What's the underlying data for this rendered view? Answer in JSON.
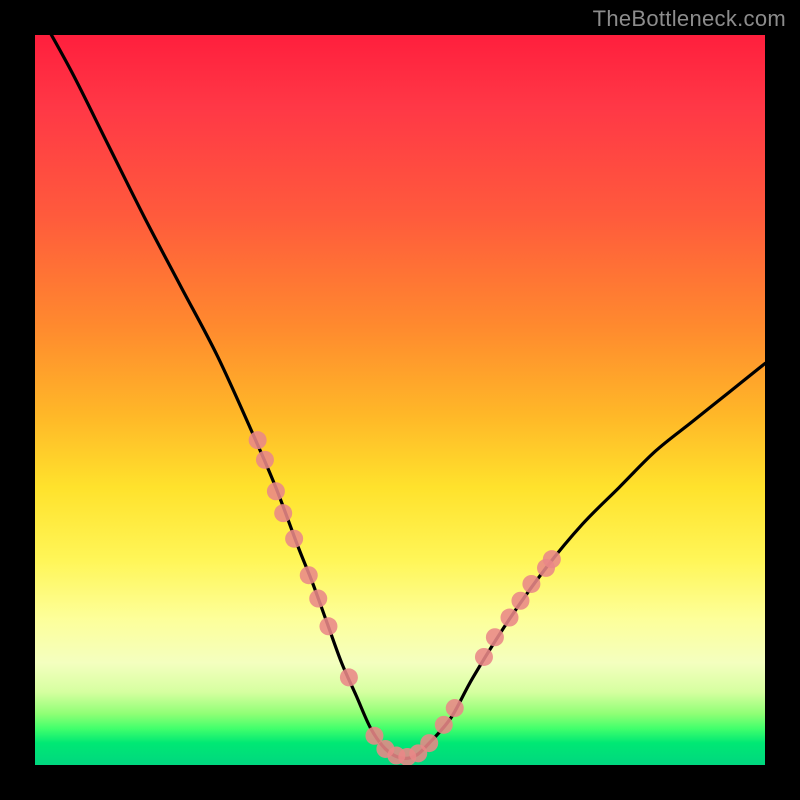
{
  "watermark": {
    "text": "TheBottleneck.com"
  },
  "colors": {
    "frame": "#000000",
    "curve": "#000000",
    "marker_fill": "#e98787",
    "marker_stroke": "#cf5a5a",
    "gradient_stops": [
      "#ff1f3d",
      "#ff5b3c",
      "#ffb728",
      "#fff658",
      "#d6ffa0",
      "#00d77f"
    ]
  },
  "chart_data": {
    "type": "line",
    "title": "",
    "xlabel": "",
    "ylabel": "",
    "xlim": [
      0,
      100
    ],
    "ylim": [
      0,
      100
    ],
    "grid": false,
    "legend": false,
    "series": [
      {
        "name": "bottleneck-curve",
        "comment": "Absolute-value-like bottleneck curve — approx V shape with curved arms (visual estimate only, no axes shown).",
        "x": [
          0,
          5,
          10,
          15,
          20,
          25,
          30,
          33,
          36,
          38,
          40,
          42,
          44,
          46,
          48,
          50,
          52,
          54,
          57,
          60,
          65,
          70,
          75,
          80,
          85,
          90,
          95,
          100
        ],
        "y": [
          104,
          95,
          85,
          75,
          65.5,
          56,
          45,
          38,
          30,
          25,
          19.5,
          14,
          9.5,
          5,
          2.2,
          1,
          1.2,
          3,
          6.5,
          12,
          20,
          27,
          33,
          38,
          43,
          47,
          51,
          55
        ]
      }
    ],
    "markers": {
      "name": "highlighted-points",
      "comment": "Salmon dot clusters along the lower portion of both arms and the valley.",
      "points": [
        {
          "x": 30.5,
          "y": 44.5
        },
        {
          "x": 31.5,
          "y": 41.8
        },
        {
          "x": 33.0,
          "y": 37.5
        },
        {
          "x": 34.0,
          "y": 34.5
        },
        {
          "x": 35.5,
          "y": 31.0
        },
        {
          "x": 37.5,
          "y": 26.0
        },
        {
          "x": 38.8,
          "y": 22.8
        },
        {
          "x": 40.2,
          "y": 19.0
        },
        {
          "x": 43.0,
          "y": 12.0
        },
        {
          "x": 46.5,
          "y": 4.0
        },
        {
          "x": 48.0,
          "y": 2.2
        },
        {
          "x": 49.5,
          "y": 1.3
        },
        {
          "x": 51.0,
          "y": 1.1
        },
        {
          "x": 52.5,
          "y": 1.6
        },
        {
          "x": 54.0,
          "y": 3.0
        },
        {
          "x": 56.0,
          "y": 5.5
        },
        {
          "x": 57.5,
          "y": 7.8
        },
        {
          "x": 61.5,
          "y": 14.8
        },
        {
          "x": 63.0,
          "y": 17.5
        },
        {
          "x": 65.0,
          "y": 20.2
        },
        {
          "x": 66.5,
          "y": 22.5
        },
        {
          "x": 68.0,
          "y": 24.8
        },
        {
          "x": 70.0,
          "y": 27.0
        },
        {
          "x": 70.8,
          "y": 28.2
        }
      ]
    }
  }
}
